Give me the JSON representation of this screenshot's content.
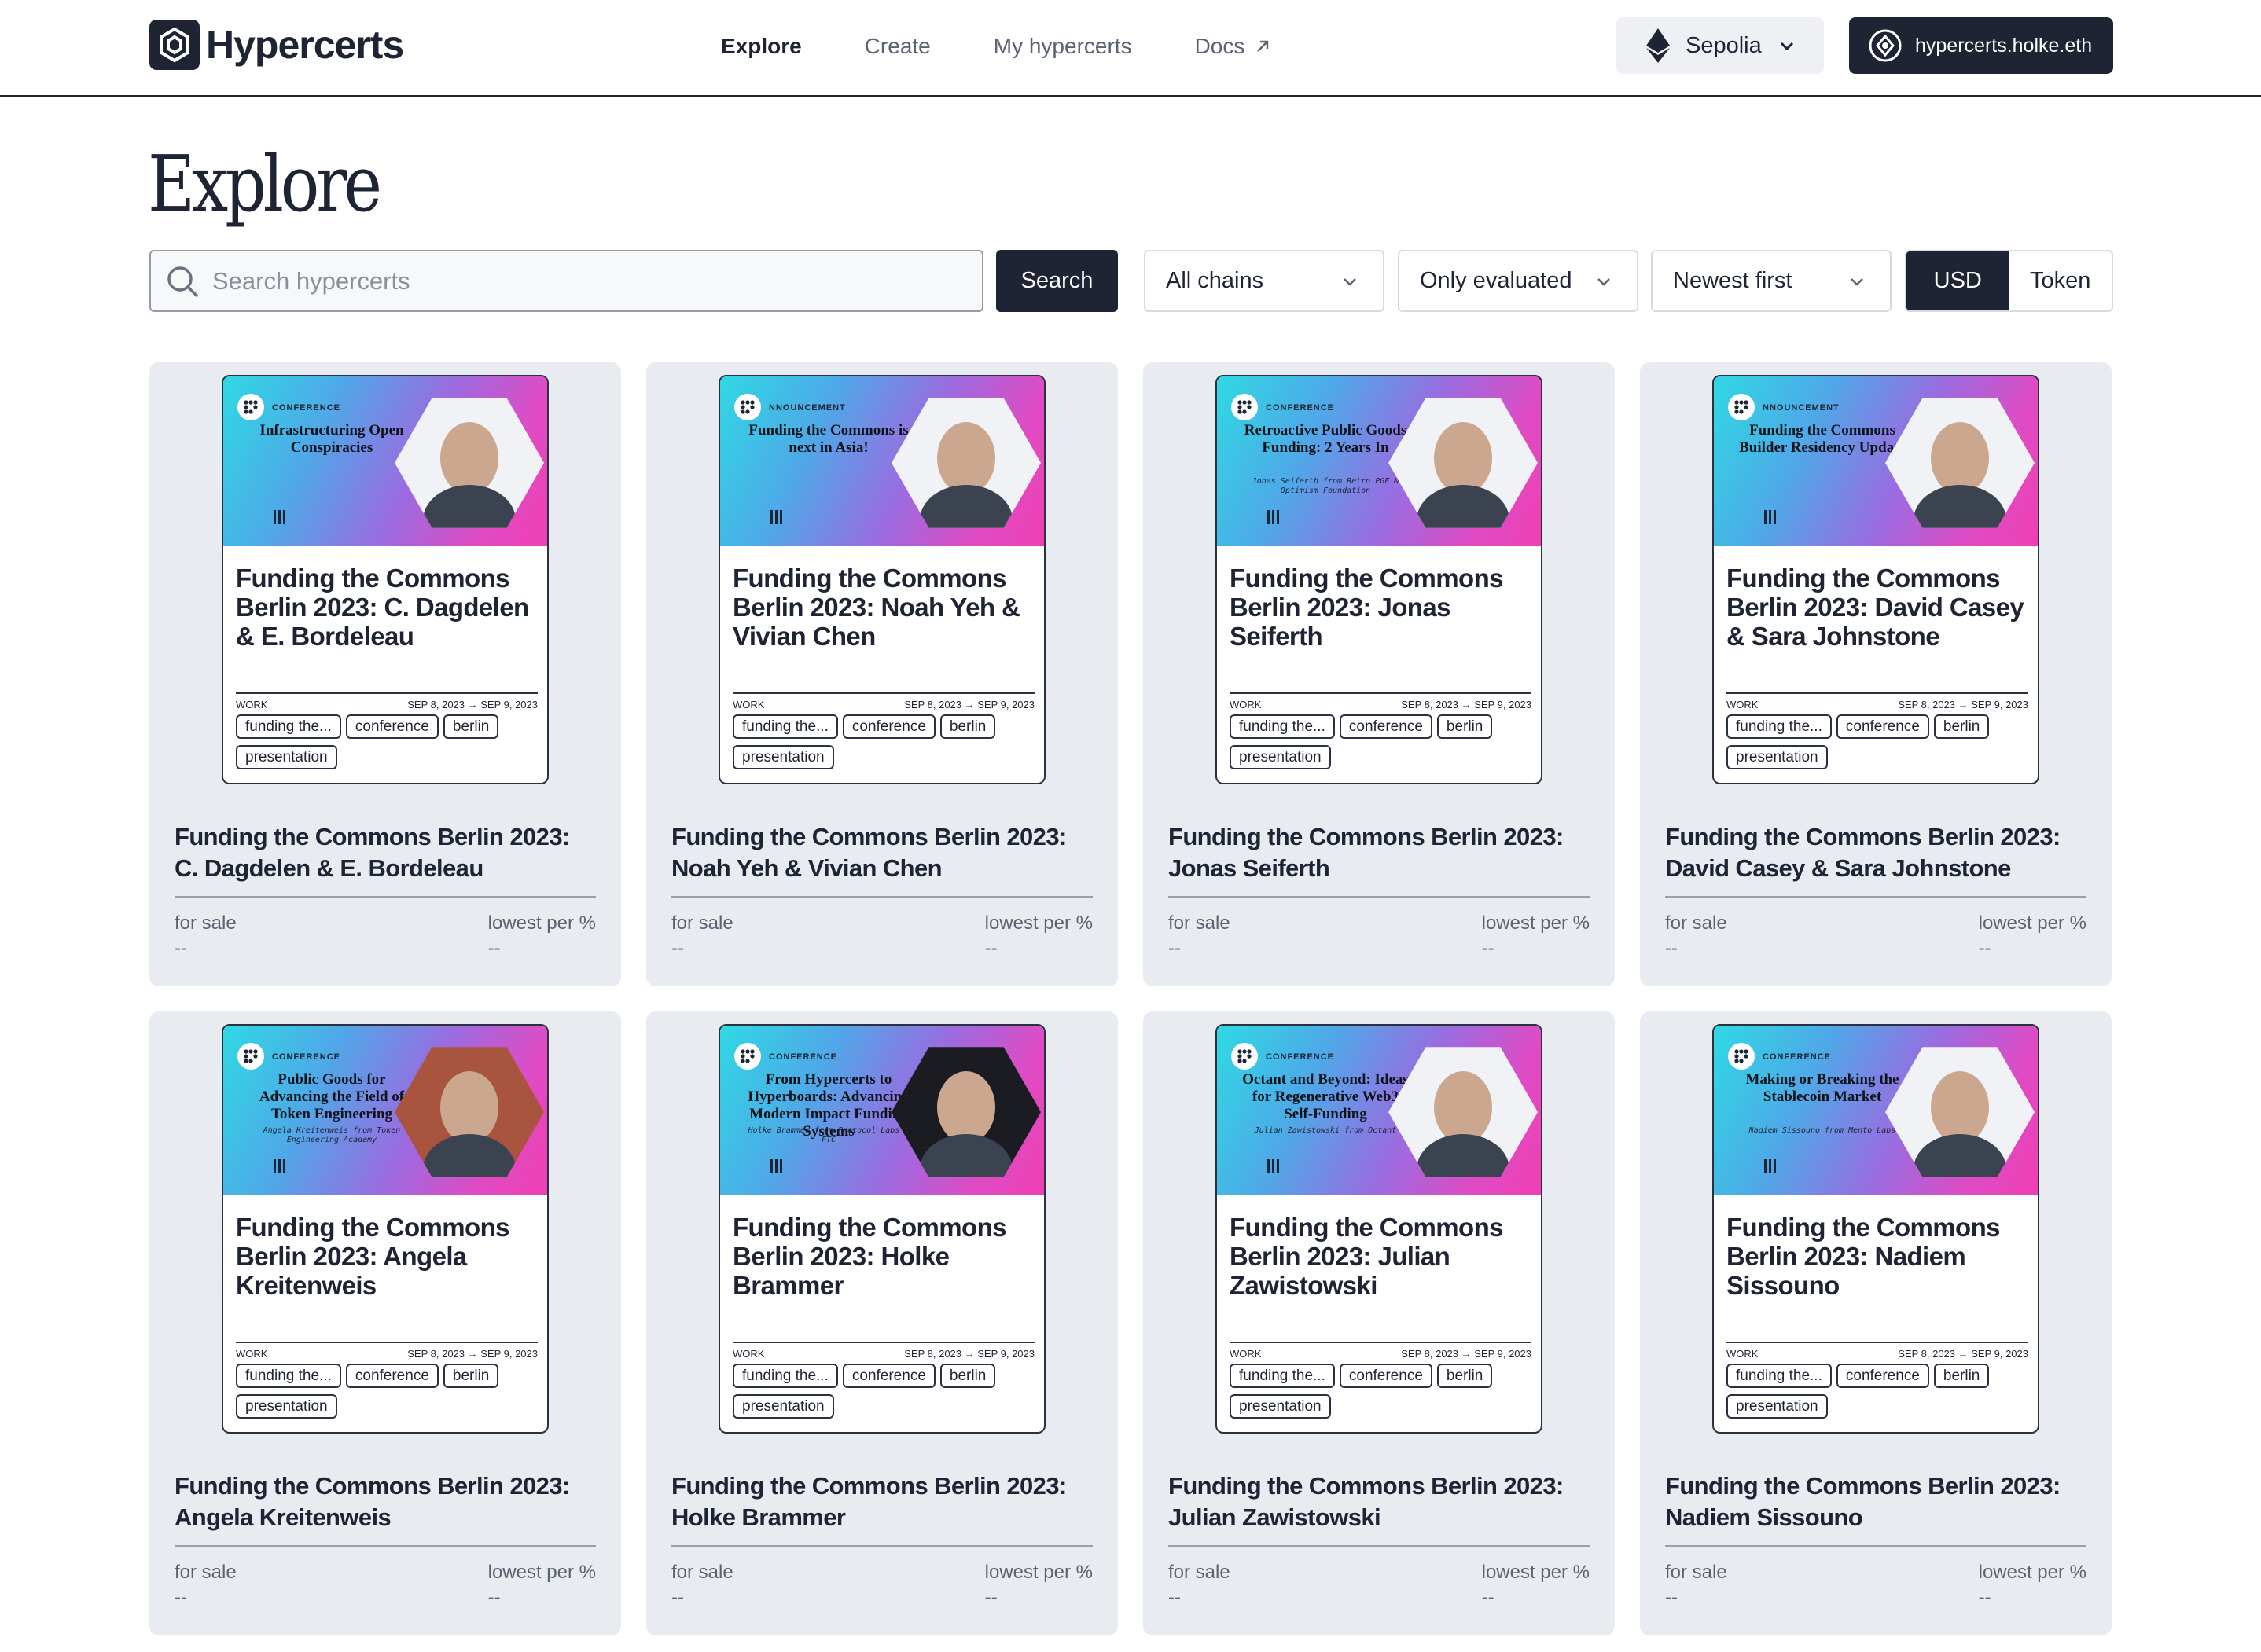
{
  "brand": {
    "name": "Hypercerts"
  },
  "nav": [
    {
      "label": "Explore",
      "active": true,
      "external": false
    },
    {
      "label": "Create",
      "active": false,
      "external": false
    },
    {
      "label": "My hypercerts",
      "active": false,
      "external": false
    },
    {
      "label": "Docs",
      "active": false,
      "external": true
    }
  ],
  "network": {
    "label": "Sepolia",
    "icon": "ethereum-icon"
  },
  "wallet": {
    "label": "hypercerts.holke.eth"
  },
  "page": {
    "title": "Explore"
  },
  "search": {
    "placeholder": "Search hypercerts",
    "value": "",
    "button": "Search"
  },
  "filters": {
    "chain": "All chains",
    "evaluation": "Only evaluated",
    "sort": "Newest first",
    "currency_options": [
      "USD",
      "Token"
    ],
    "currency_selected": "USD"
  },
  "colors": {
    "dark": "#1e2433",
    "card_bg": "#e8ebf0",
    "banner_start": "#2fd9e3",
    "banner_end": "#ef3fb2"
  },
  "card_labels": {
    "for_sale": "for sale",
    "lowest": "lowest per %",
    "work": "WORK",
    "dates": "SEP 8, 2023 → SEP 9, 2023"
  },
  "cards": [
    {
      "mini_title": "Funding the Commons Berlin 2023: C. Dagdelen & E. Bordeleau",
      "title": "Funding the Commons Berlin 2023: C. Dagdelen & E. Bordeleau",
      "tags": [
        "funding the...",
        "conference",
        "berlin",
        "presentation"
      ],
      "for_sale": "--",
      "lowest": "--",
      "banner": {
        "kind": "CONFERENCE",
        "title": "Infrastructuring Open Conspiracies",
        "sub": ""
      }
    },
    {
      "mini_title": "Funding the Commons Berlin 2023: Noah Yeh & Vivian Chen",
      "title": "Funding the Commons Berlin 2023: Noah Yeh & Vivian Chen",
      "tags": [
        "funding the...",
        "conference",
        "berlin",
        "presentation"
      ],
      "for_sale": "--",
      "lowest": "--",
      "banner": {
        "kind": "NNOUNCEMENT",
        "title": "Funding the Commons is next in Asia!",
        "sub": ""
      }
    },
    {
      "mini_title": "Funding the Commons Berlin 2023: Jonas Seiferth",
      "title": "Funding the Commons Berlin 2023: Jonas Seiferth",
      "tags": [
        "funding the...",
        "conference",
        "berlin",
        "presentation"
      ],
      "for_sale": "--",
      "lowest": "--",
      "banner": {
        "kind": "CONFERENCE",
        "title": "Retroactive Public Goods Funding: 2 Years In",
        "sub": "Jonas Seiferth from Retro PGF & Optimism Foundation"
      }
    },
    {
      "mini_title": "Funding the Commons Berlin 2023: David Casey & Sara Johnstone",
      "title": "Funding the Commons Berlin 2023: David Casey & Sara Johnstone",
      "tags": [
        "funding the...",
        "conference",
        "berlin",
        "presentation"
      ],
      "for_sale": "--",
      "lowest": "--",
      "banner": {
        "kind": "NNOUNCEMENT",
        "title": "Funding the Commons Builder Residency Update",
        "sub": ""
      }
    },
    {
      "mini_title": "Funding the Commons Berlin 2023: Angela Kreitenweis",
      "title": "Funding the Commons Berlin 2023: Angela Kreitenweis",
      "tags": [
        "funding the...",
        "conference",
        "berlin",
        "presentation"
      ],
      "for_sale": "--",
      "lowest": "--",
      "banner": {
        "kind": "CONFERENCE",
        "title": "Public Goods for Advancing the Field of Token Engineering",
        "sub": "Angela Kreitenweis from Token Engineering Academy"
      }
    },
    {
      "mini_title": "Funding the Commons Berlin 2023: Holke Brammer",
      "title": "Funding the Commons Berlin 2023: Holke Brammer",
      "tags": [
        "funding the...",
        "conference",
        "berlin",
        "presentation"
      ],
      "for_sale": "--",
      "lowest": "--",
      "banner": {
        "kind": "CONFERENCE",
        "title": "From Hypercerts to Hyperboards: Advancing Modern Impact Funding Systems",
        "sub": "Holke Brammer from Protocol Labs & FTC"
      }
    },
    {
      "mini_title": "Funding the Commons Berlin 2023: Julian Zawistowski",
      "title": "Funding the Commons Berlin 2023: Julian Zawistowski",
      "tags": [
        "funding the...",
        "conference",
        "berlin",
        "presentation"
      ],
      "for_sale": "--",
      "lowest": "--",
      "banner": {
        "kind": "CONFERENCE",
        "title": "Octant and Beyond: Ideas for Regenerative Web3 Self-Funding",
        "sub": "Julian Zawistowski from Octant"
      }
    },
    {
      "mini_title": "Funding the Commons Berlin 2023: Nadiem Sissouno",
      "title": "Funding the Commons Berlin 2023: Nadiem Sissouno",
      "tags": [
        "funding the...",
        "conference",
        "berlin",
        "presentation"
      ],
      "for_sale": "--",
      "lowest": "--",
      "banner": {
        "kind": "CONFERENCE",
        "title": "Making or Breaking the Stablecoin Market",
        "sub": "Nadiem Sissouno from Mento Labs"
      }
    }
  ]
}
